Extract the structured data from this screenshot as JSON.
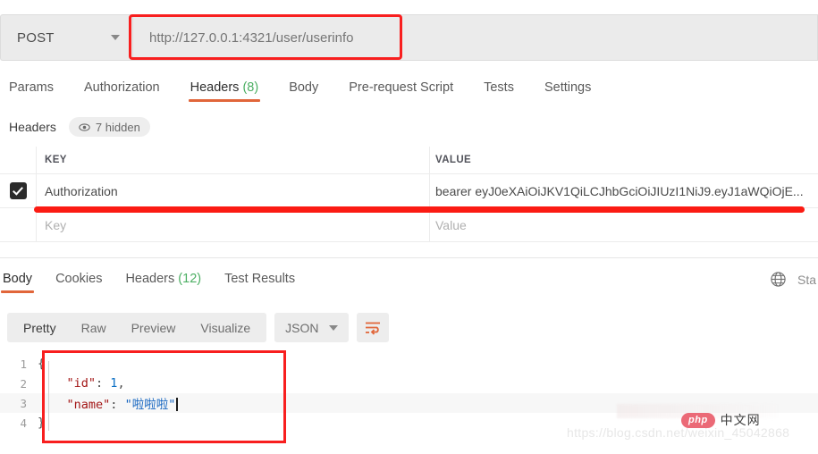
{
  "request": {
    "method": "POST",
    "method_caret_icon": "chevron-down-icon",
    "url": "http://127.0.0.1:4321/user/userinfo",
    "tabs": [
      {
        "label": "Params",
        "active": false
      },
      {
        "label": "Authorization",
        "active": false
      },
      {
        "label": "Headers",
        "count": "(8)",
        "active": true
      },
      {
        "label": "Body",
        "active": false
      },
      {
        "label": "Pre-request Script",
        "active": false
      },
      {
        "label": "Tests",
        "active": false
      },
      {
        "label": "Settings",
        "active": false
      }
    ],
    "headers_section": {
      "label": "Headers",
      "hidden_pill": "7 hidden",
      "eye_icon": "eye-icon"
    },
    "table": {
      "columns": [
        "KEY",
        "VALUE"
      ],
      "rows": [
        {
          "checked": true,
          "key": "Authorization",
          "value": "bearer eyJ0eXAiOiJKV1QiLCJhbGciOiJIUzI1NiJ9.eyJ1aWQiOjE..."
        }
      ],
      "placeholder_row": {
        "key": "Key",
        "value": "Value"
      }
    }
  },
  "response": {
    "tabs": [
      {
        "label": "Body",
        "active": true
      },
      {
        "label": "Cookies",
        "active": false
      },
      {
        "label": "Headers",
        "count": "(12)",
        "active": false
      },
      {
        "label": "Test Results",
        "active": false
      }
    ],
    "globe_icon": "globe-icon",
    "status_text": "Sta",
    "format_tabs": [
      {
        "label": "Pretty",
        "active": true
      },
      {
        "label": "Raw",
        "active": false
      },
      {
        "label": "Preview",
        "active": false
      },
      {
        "label": "Visualize",
        "active": false
      }
    ],
    "content_type": "JSON",
    "content_type_caret_icon": "chevron-down-icon",
    "wrap_icon": "word-wrap-icon",
    "body_lines": [
      {
        "num": "1",
        "tokens": [
          {
            "t": "{",
            "c": "punc"
          }
        ],
        "highlight": false
      },
      {
        "num": "2",
        "tokens": [
          {
            "t": "    ",
            "c": "punc"
          },
          {
            "t": "\"id\"",
            "c": "key"
          },
          {
            "t": ": ",
            "c": "punc"
          },
          {
            "t": "1",
            "c": "num"
          },
          {
            "t": ",",
            "c": "punc"
          }
        ],
        "highlight": false
      },
      {
        "num": "3",
        "tokens": [
          {
            "t": "    ",
            "c": "punc"
          },
          {
            "t": "\"name\"",
            "c": "key"
          },
          {
            "t": ": ",
            "c": "punc"
          },
          {
            "t": "\"啦啦啦\"",
            "c": "str"
          }
        ],
        "highlight": true,
        "cursor": true
      },
      {
        "num": "4",
        "tokens": [
          {
            "t": "}",
            "c": "punc"
          }
        ],
        "highlight": false
      }
    ]
  },
  "annotations": {
    "url_box_color": "#f81f1f",
    "row_underline_color": "#fb1b13",
    "code_box_color": "#f81f1f"
  },
  "watermark": {
    "url": "https://blog.csdn.net/weixin_45042868",
    "logo_badge": "php",
    "logo_text": "中文网"
  }
}
